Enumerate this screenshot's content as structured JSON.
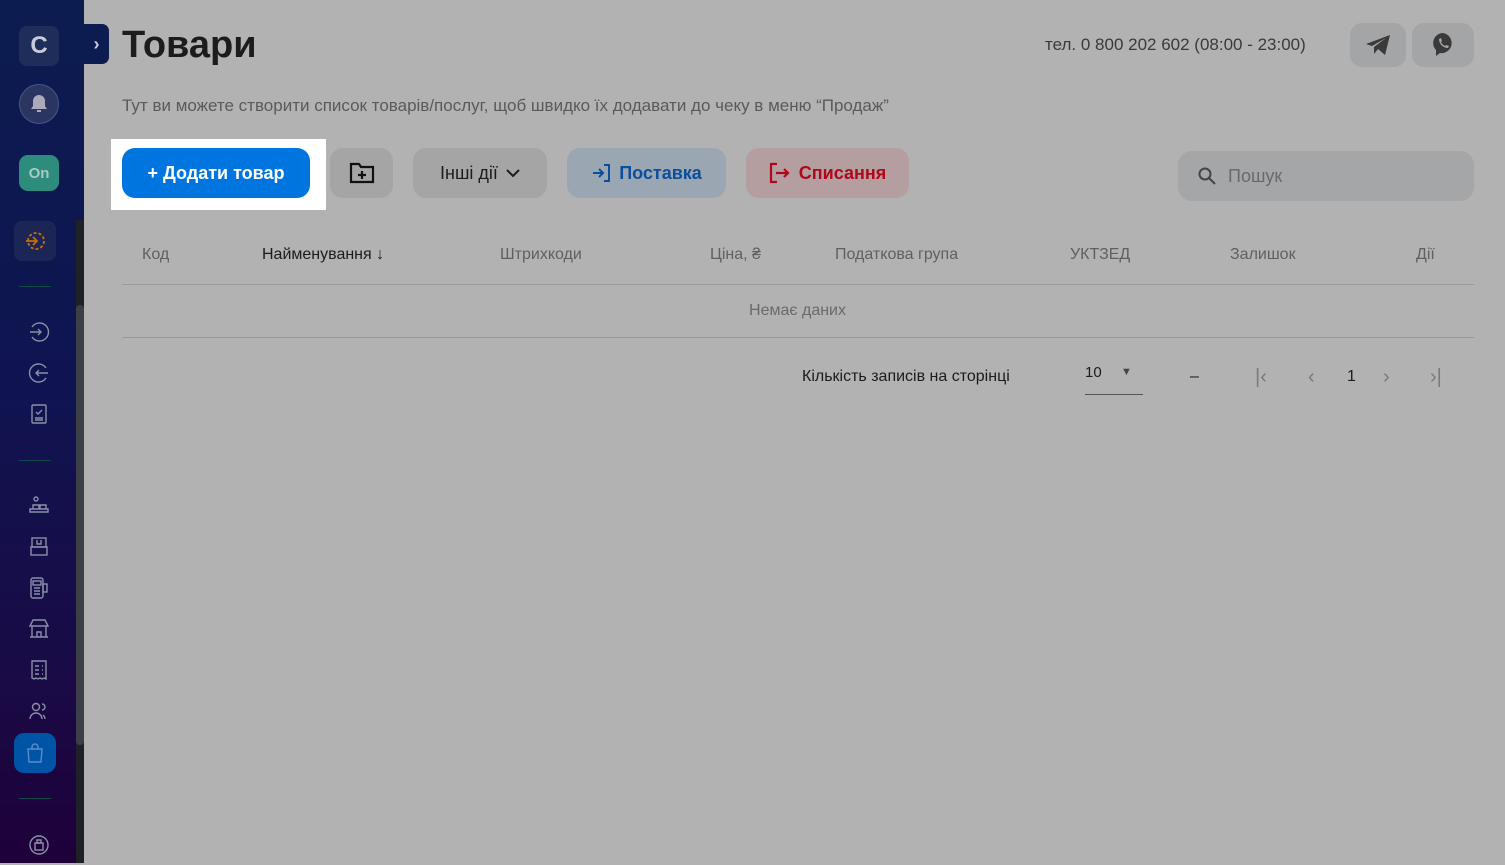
{
  "sidebar": {
    "logo": "C",
    "status_badge": "On",
    "items": [
      "shift-icon",
      "incoming-icon",
      "outgoing-icon",
      "report-icon",
      "cashiers-icon",
      "cash-register-icon",
      "terminal-icon",
      "store-icon",
      "receipts-icon",
      "users-icon",
      "products-icon",
      "support-icon"
    ]
  },
  "header": {
    "title": "Товари",
    "phone": "тел. 0 800 202 602 (08:00 - 23:00)"
  },
  "description": "Тут ви можете створити список товарів/послуг, щоб швидко їх додавати до чеку в меню “Продаж”",
  "toolbar": {
    "add_label": "+ Додати товар",
    "other_label": "Інші дії",
    "supply_label": "Поставка",
    "writeoff_label": "Списання",
    "search_placeholder": "Пошук"
  },
  "table": {
    "columns": [
      "Код",
      "Найменування",
      "Штрихкоди",
      "Ціна, ₴",
      "Податкова група",
      "УКТЗЕД",
      "Залишок",
      "Дії"
    ],
    "sort_arrow": "↓",
    "empty": "Немає даних"
  },
  "pagination": {
    "per_page_label": "Кількість записів на сторінці",
    "per_page": "10",
    "range": "–",
    "page": "1"
  },
  "colors": {
    "primary": "#0075e0",
    "supply": "#0b4f9c",
    "writeoff": "#b1071a",
    "sidebar": "#0c1c50"
  }
}
